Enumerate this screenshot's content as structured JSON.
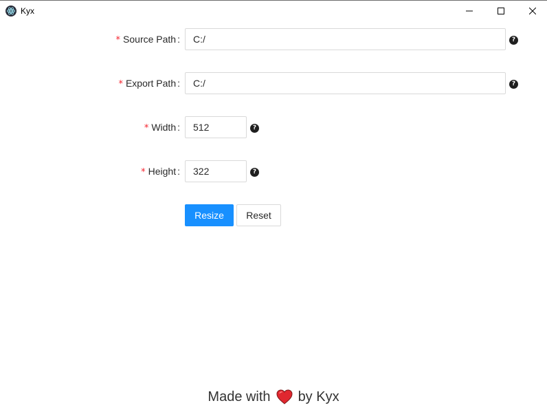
{
  "window": {
    "title": "Kyx",
    "icon": "electron-atom-icon",
    "controls": [
      "minimize",
      "maximize",
      "close"
    ]
  },
  "form": {
    "fields": [
      {
        "label": "Source Path",
        "required_mark": "*",
        "colon": ":",
        "value": "C:/",
        "help_icon": "?"
      },
      {
        "label": "Export Path",
        "required_mark": "*",
        "colon": ":",
        "value": "C:/",
        "help_icon": "?"
      },
      {
        "label": "Width",
        "required_mark": "*",
        "colon": ":",
        "value": "512",
        "help_icon": "?"
      },
      {
        "label": "Height",
        "required_mark": "*",
        "colon": ":",
        "value": "322",
        "help_icon": "?"
      }
    ],
    "buttons": {
      "resize_label": "Resize",
      "reset_label": "Reset"
    }
  },
  "footer": {
    "prefix": "Made with",
    "icon": "heart-icon",
    "suffix": "by Kyx"
  },
  "colors": {
    "primary": "#1890ff",
    "required": "#f5222d",
    "heart": "#e0272f"
  }
}
